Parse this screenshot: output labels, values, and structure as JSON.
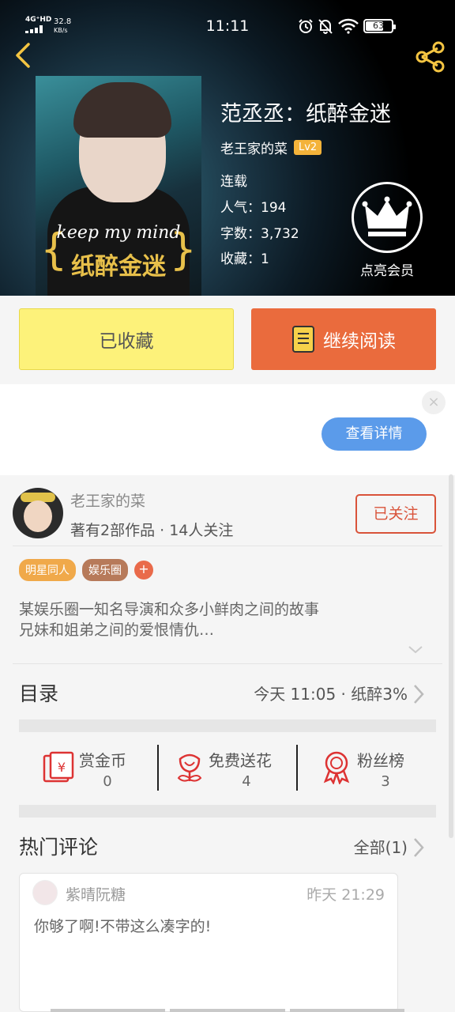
{
  "status_bar": {
    "network": "4G⁺HD",
    "speed_value": "32.8",
    "speed_unit": "KB/s",
    "time": "11:11",
    "battery": "63"
  },
  "book": {
    "title": "范丞丞：纸醉金迷",
    "author": "老王家的菜",
    "author_level": "Lv2",
    "status": "连载",
    "popularity_line": "人气：194",
    "words_line": "字数：3,732",
    "favorites_line": "收藏：1",
    "cover_text_en": "keep my mind",
    "cover_text_cn": "纸醉金迷"
  },
  "vip": {
    "label": "点亮会员"
  },
  "actions": {
    "favorited_label": "已收藏",
    "continue_label": "继续阅读"
  },
  "ad": {
    "close": "×",
    "detail_button": "查看详情"
  },
  "author_card": {
    "name": "老王家的菜",
    "stats": "著有2部作品 · 14人关注",
    "follow_label": "已关注"
  },
  "tags": [
    "明星同人",
    "娱乐圈",
    "+"
  ],
  "description": {
    "line1": "某娱乐圈一知名导演和众多小鲜肉之间的故事",
    "line2": "兄妹和姐弟之间的爱恨情仇…"
  },
  "toc": {
    "title": "目录",
    "latest": "今天 11:05 · 纸醉3%"
  },
  "rewards": [
    {
      "label": "赏金币",
      "value": "0",
      "icon": "red-envelope-icon"
    },
    {
      "label": "免费送花",
      "value": "4",
      "icon": "flower-icon"
    },
    {
      "label": "粉丝榜",
      "value": "3",
      "icon": "medal-icon"
    }
  ],
  "comments": {
    "title": "热门评论",
    "all_label": "全部(1)",
    "items": [
      {
        "user": "紫晴阮糖",
        "time": "昨天 21:29",
        "text": "你够了啊!不带这么凑字的!"
      }
    ]
  },
  "colors": {
    "accent_orange": "#ea6b3d",
    "favorite_yellow": "#fdf27a",
    "follow_red": "#d9533a",
    "ad_blue": "#5b9bea",
    "level_badge": "#f4b33a"
  }
}
